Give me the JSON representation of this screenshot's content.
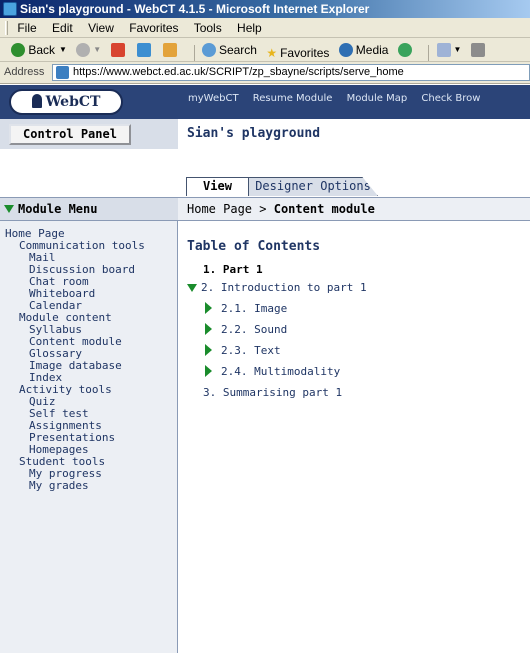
{
  "browser": {
    "window_title": "Sian's playground - WebCT 4.1.5 - Microsoft Internet Explorer",
    "menus": [
      "File",
      "Edit",
      "View",
      "Favorites",
      "Tools",
      "Help"
    ],
    "toolbar": {
      "back": "Back",
      "search": "Search",
      "favorites": "Favorites",
      "media": "Media"
    },
    "address_label": "Address",
    "url": "https://www.webct.ed.ac.uk/SCRIPT/zp_sbayne/scripts/serve_home"
  },
  "webct": {
    "logo_text": "WebCT",
    "topnav": [
      "myWebCT",
      "Resume Module",
      "Module Map",
      "Check Brow"
    ],
    "control_panel_label": "Control Panel",
    "course_title": "Sian's playground",
    "tabs": {
      "view": "View",
      "designer": "Designer Options"
    }
  },
  "module_menu": {
    "header": "Module Menu",
    "items": [
      {
        "label": "Home Page",
        "level": 0
      },
      {
        "label": "Communication tools",
        "level": 1
      },
      {
        "label": "Mail",
        "level": 2
      },
      {
        "label": "Discussion board",
        "level": 2
      },
      {
        "label": "Chat room",
        "level": 2
      },
      {
        "label": "Whiteboard",
        "level": 2
      },
      {
        "label": "Calendar",
        "level": 2
      },
      {
        "label": "Module content",
        "level": 1
      },
      {
        "label": "Syllabus",
        "level": 2
      },
      {
        "label": "Content module",
        "level": 2
      },
      {
        "label": "Glossary",
        "level": 2
      },
      {
        "label": "Image database",
        "level": 2
      },
      {
        "label": "Index",
        "level": 2
      },
      {
        "label": "Activity tools",
        "level": 1
      },
      {
        "label": "Quiz",
        "level": 2
      },
      {
        "label": "Self test",
        "level": 2
      },
      {
        "label": "Assignments",
        "level": 2
      },
      {
        "label": "Presentations",
        "level": 2
      },
      {
        "label": "Homepages",
        "level": 2
      },
      {
        "label": "Student tools",
        "level": 1
      },
      {
        "label": "My progress",
        "level": 2
      },
      {
        "label": "My grades",
        "level": 2
      }
    ]
  },
  "breadcrumb": {
    "home": "Home Page",
    "separator": ">",
    "current": "Content module"
  },
  "toc": {
    "title": "Table of Contents",
    "part1": "1. Part 1",
    "intro": "2. Introduction to part 1",
    "image": "2.1. Image",
    "sound": "2.2. Sound",
    "text": "2.3. Text",
    "multimodality": "2.4. Multimodality",
    "summarising": "3. Summarising part 1"
  },
  "colors": {
    "header_bg": "#2b4478",
    "nav_text": "#1f3564",
    "arrow_green": "#1a8c2c",
    "panel_bg": "#d8dee8"
  }
}
